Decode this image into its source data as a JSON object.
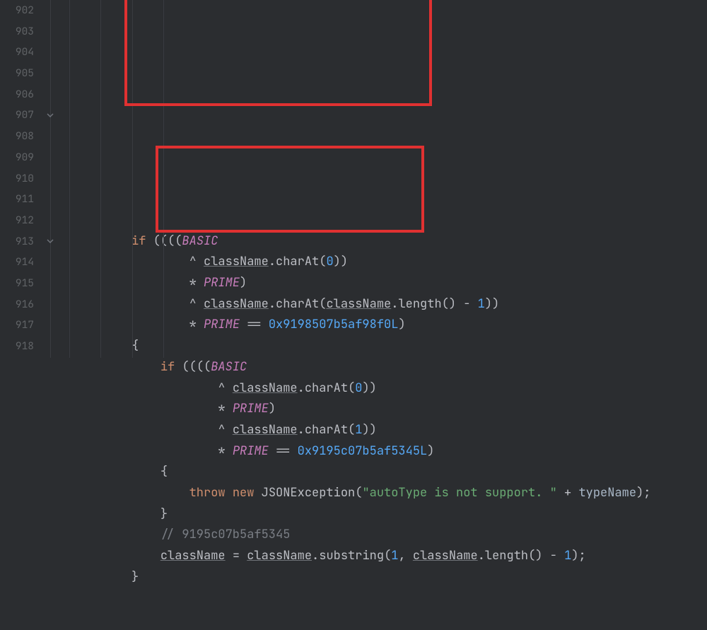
{
  "lineStart": 902,
  "lineCount": 17,
  "code": {
    "kw_if": "if",
    "kw_throw": "throw",
    "kw_new": "new",
    "const_BASIC": "BASIC",
    "const_PRIME": "PRIME",
    "fld_className": "className",
    "mth_charAt": "charAt",
    "mth_length": "length",
    "mth_substring": "substring",
    "num_0": "0",
    "num_1": "1",
    "hex1": "0x9198507b5af98f0L",
    "hex2": "0x9195c07b5af5345L",
    "cls_JSONException": "JSONException",
    "str_err": "\"autoType is not support. \"",
    "id_typeName": "typeName",
    "cmt_hash": "// 9195c07b5af5345",
    "brace_open": "{",
    "brace_close": "}",
    "op_eq": "==",
    "op_caret": "^",
    "op_star": "*",
    "op_plus": "+",
    "op_minus": "-",
    "op_assign": "=",
    "op_semi": ";",
    "op_comma": ",",
    "op_dot": "."
  }
}
